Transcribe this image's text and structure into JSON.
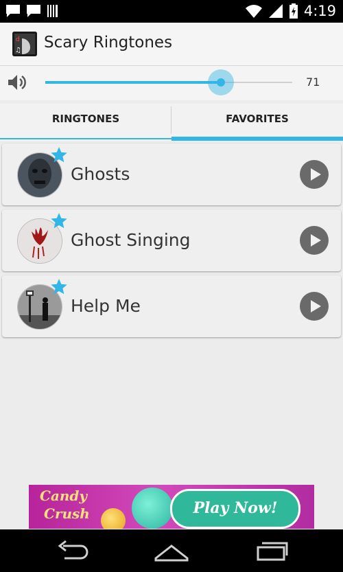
{
  "status": {
    "time": "4:19"
  },
  "app": {
    "title": "Scary Ringtones"
  },
  "volume": {
    "value": "71",
    "level": 0.71,
    "accent": "#33b5e5"
  },
  "tabs": [
    {
      "label": "RINGTONES",
      "selected": false
    },
    {
      "label": "FAVORITES",
      "selected": true
    }
  ],
  "ringtones": [
    {
      "title": "Ghosts",
      "favorite": true
    },
    {
      "title": "Ghost Singing",
      "favorite": true
    },
    {
      "title": "Help Me",
      "favorite": true
    }
  ],
  "ad": {
    "brand_line1": "Candy",
    "brand_line2": "Crush",
    "cta": "Play Now!"
  }
}
